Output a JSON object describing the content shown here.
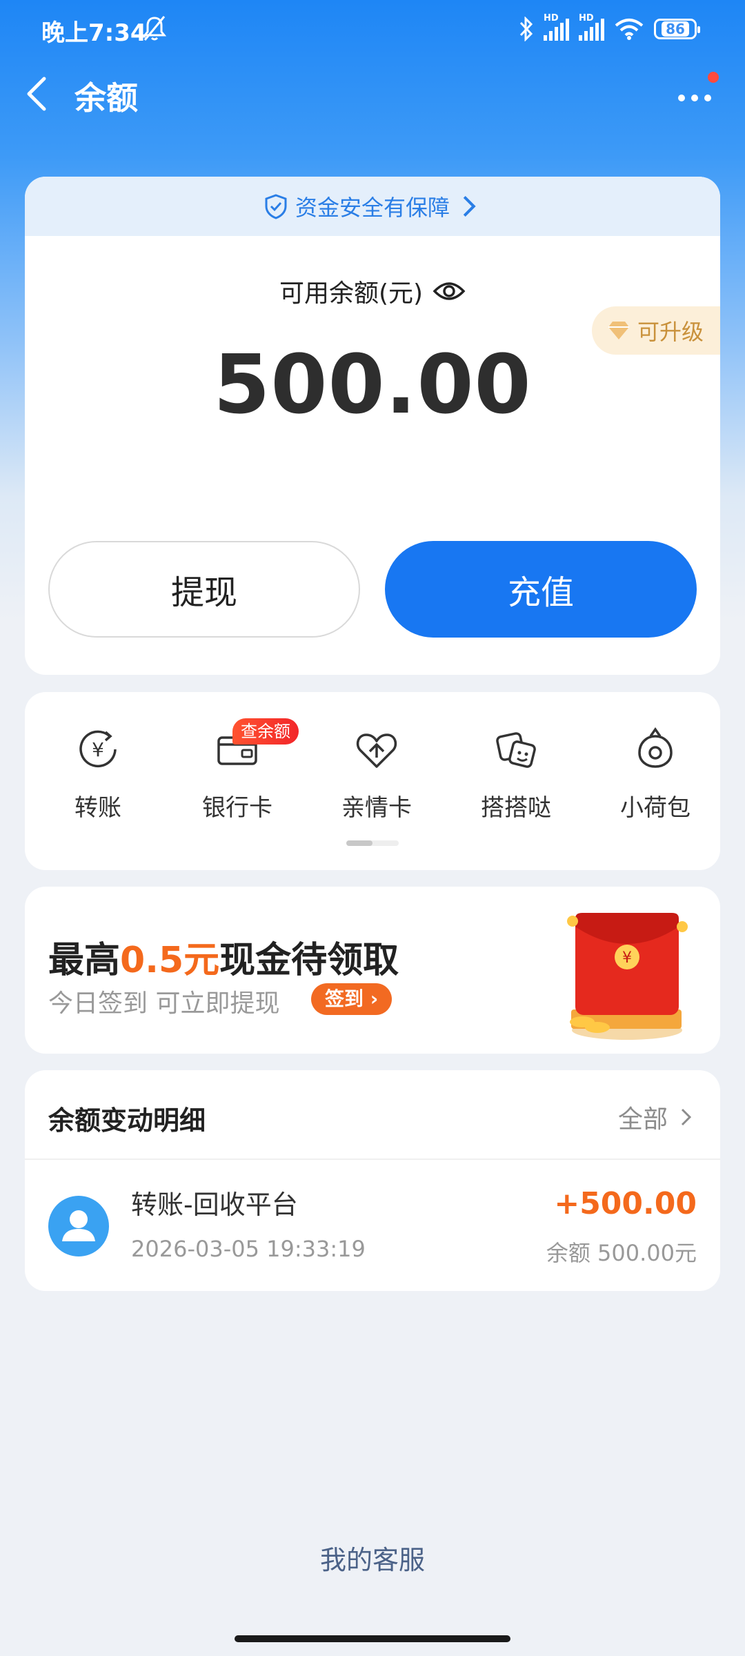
{
  "status_bar": {
    "time": "晚上7:34",
    "network_label": "HD",
    "battery": "86"
  },
  "nav": {
    "title": "余额"
  },
  "balance": {
    "safety_text": "资金安全有保障",
    "label": "可用余额(元)",
    "amount": "500.00",
    "upgrade": "可升级",
    "withdraw": "提现",
    "recharge": "充值"
  },
  "services": {
    "items": [
      {
        "label": "转账",
        "icon": "transfer-icon"
      },
      {
        "label": "银行卡",
        "icon": "bank-card-icon"
      },
      {
        "label": "亲情卡",
        "icon": "family-card-icon"
      },
      {
        "label": "搭搭哒",
        "icon": "dadada-icon"
      },
      {
        "label": "小荷包",
        "icon": "wallet-icon"
      }
    ],
    "bank_badge": "查余额"
  },
  "promo": {
    "title_prefix": "最高",
    "title_highlight": "0.5元",
    "title_suffix": "现金待领取",
    "subtitle": "今日签到 可立即提现",
    "button": "签到",
    "currency_symbol": "¥"
  },
  "transactions": {
    "title": "余额变动明细",
    "all": "全部",
    "items": [
      {
        "name": "转账-回收平台",
        "time": "2026-03-05 19:33:19",
        "amount": "+500.00",
        "balance": "余额 500.00元"
      }
    ]
  },
  "footer": {
    "service": "我的客服"
  },
  "colors": {
    "primary": "#1877f2",
    "accent": "#f4691c",
    "gold": "#c9913b"
  }
}
